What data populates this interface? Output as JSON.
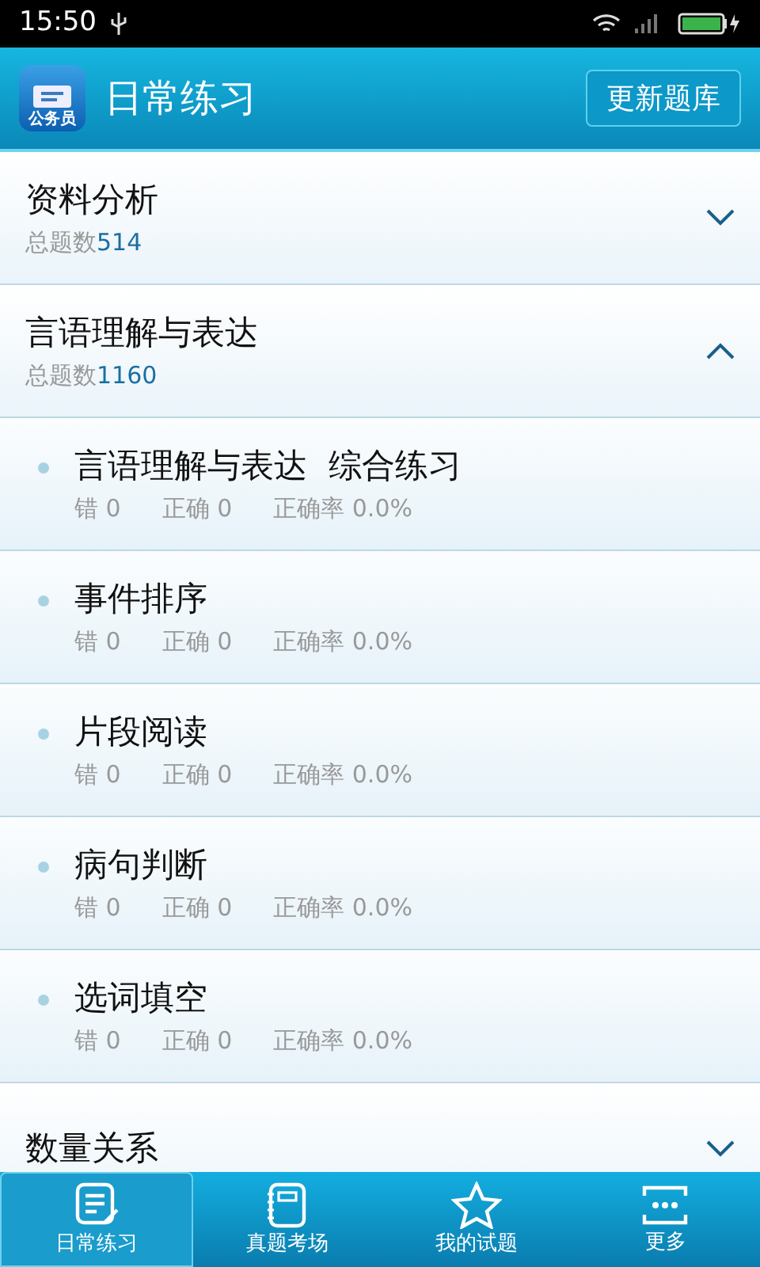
{
  "status_bar": {
    "time": "15:50"
  },
  "header": {
    "app_icon_label": "公务员",
    "title": "日常练习",
    "update_button": "更新题库"
  },
  "categories": [
    {
      "name": "资料分析",
      "count_label": "总题数",
      "count": "514",
      "expanded": false
    },
    {
      "name": "言语理解与表达",
      "count_label": "总题数",
      "count": "1160",
      "expanded": true,
      "children": [
        {
          "name": "言语理解与表达  综合练习",
          "wrong": "错 0",
          "correct": "正确 0",
          "rate": "正确率 0.0%"
        },
        {
          "name": "事件排序",
          "wrong": "错 0",
          "correct": "正确 0",
          "rate": "正确率 0.0%"
        },
        {
          "name": "片段阅读",
          "wrong": "错 0",
          "correct": "正确 0",
          "rate": "正确率 0.0%"
        },
        {
          "name": "病句判断",
          "wrong": "错 0",
          "correct": "正确 0",
          "rate": "正确率 0.0%"
        },
        {
          "name": "选词填空",
          "wrong": "错 0",
          "correct": "正确 0",
          "rate": "正确率 0.0%"
        }
      ]
    },
    {
      "name": "数量关系",
      "expanded": false
    }
  ],
  "tabs": [
    {
      "label": "日常练习",
      "kind": "practice",
      "selected": true
    },
    {
      "label": "真题考场",
      "kind": "exam",
      "selected": false
    },
    {
      "label": "我的试题",
      "kind": "favorites",
      "selected": false
    },
    {
      "label": "更多",
      "kind": "more",
      "selected": false
    }
  ]
}
